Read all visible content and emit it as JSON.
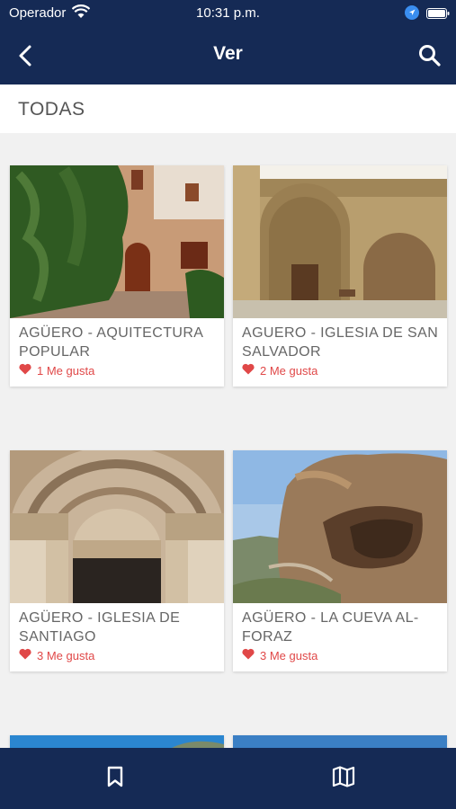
{
  "status_bar": {
    "carrier": "Operador",
    "time": "10:31 p.m."
  },
  "nav": {
    "title": "Ver",
    "back_icon": "chevron-left-icon",
    "search_icon": "search-icon"
  },
  "section": {
    "title": "TODAS"
  },
  "cards": [
    {
      "title": "AGÜERO - AQUITECTURA POPULAR",
      "likes": "1 Me gusta"
    },
    {
      "title": "AGUERO - IGLESIA DE SAN SALVADOR",
      "likes": "2 Me gusta"
    },
    {
      "title": "AGÜERO - IGLESIA DE SANTIAGO",
      "likes": "3 Me gusta"
    },
    {
      "title": "AGÜERO - LA CUEVA AL-FORAZ",
      "likes": "3 Me gusta"
    }
  ],
  "tab_bar": {
    "items": [
      "bookmark-icon",
      "map-icon"
    ]
  },
  "colors": {
    "brand": "#152a55",
    "like": "#e04848"
  }
}
